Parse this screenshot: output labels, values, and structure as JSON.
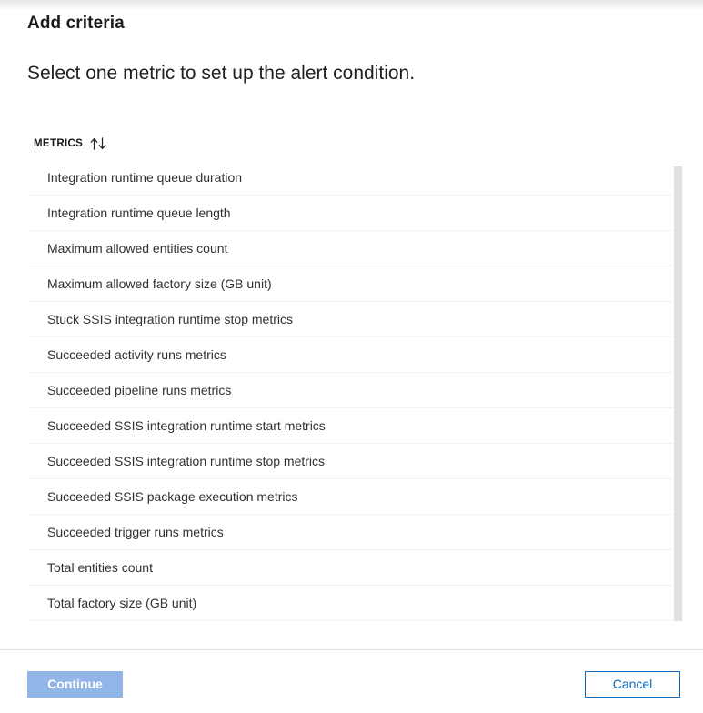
{
  "blade": {
    "title": "Add criteria",
    "subtitle": "Select one metric to set up the alert condition."
  },
  "list": {
    "header_label": "METRICS",
    "sort_icon": "sort-ascending-descending-icon",
    "items": [
      {
        "label": "Integration runtime queue duration"
      },
      {
        "label": "Integration runtime queue length"
      },
      {
        "label": "Maximum allowed entities count"
      },
      {
        "label": "Maximum allowed factory size (GB unit)"
      },
      {
        "label": "Stuck SSIS integration runtime stop metrics"
      },
      {
        "label": "Succeeded activity runs metrics"
      },
      {
        "label": "Succeeded pipeline runs metrics"
      },
      {
        "label": "Succeeded SSIS integration runtime start metrics"
      },
      {
        "label": "Succeeded SSIS integration runtime stop metrics"
      },
      {
        "label": "Succeeded SSIS package execution metrics"
      },
      {
        "label": "Succeeded trigger runs metrics"
      },
      {
        "label": "Total entities count"
      },
      {
        "label": "Total factory size (GB unit)"
      }
    ]
  },
  "scrollbar": {
    "thumb_color": "#e1e1e1"
  },
  "footer": {
    "continue_label": "Continue",
    "cancel_label": "Cancel",
    "continue_bg": "#92b5e8",
    "cancel_accent": "#0f6cbd"
  }
}
